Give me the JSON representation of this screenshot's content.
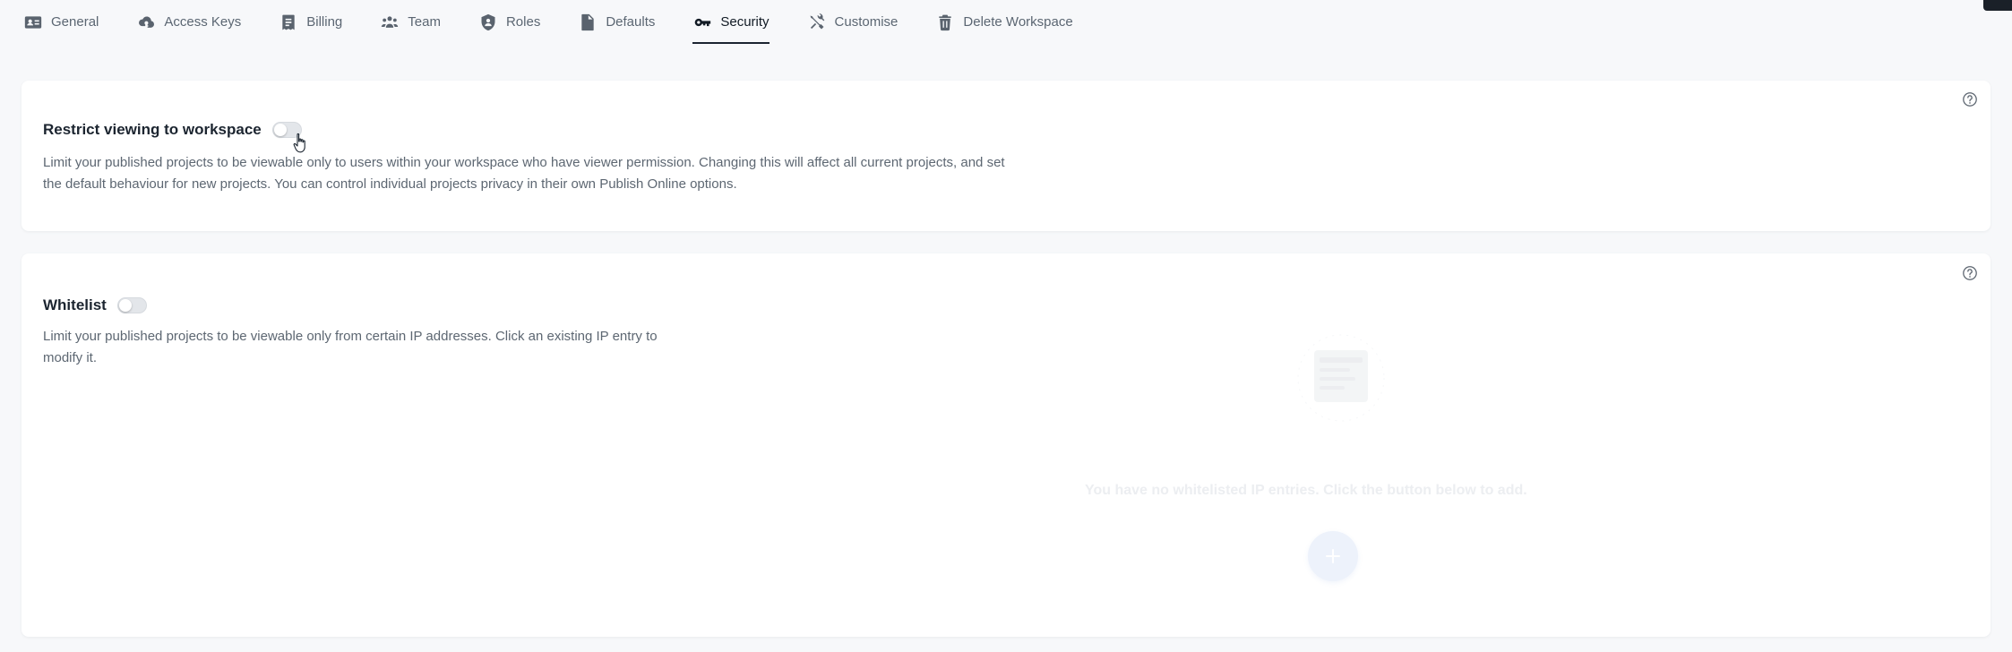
{
  "tabs": [
    {
      "label": "General",
      "icon": "id-card-icon"
    },
    {
      "label": "Access Keys",
      "icon": "cloud-key-icon"
    },
    {
      "label": "Billing",
      "icon": "receipt-icon"
    },
    {
      "label": "Team",
      "icon": "users-icon"
    },
    {
      "label": "Roles",
      "icon": "user-shield-icon"
    },
    {
      "label": "Defaults",
      "icon": "file-icon"
    },
    {
      "label": "Security",
      "icon": "key-icon",
      "active": true
    },
    {
      "label": "Customise",
      "icon": "tools-icon"
    },
    {
      "label": "Delete Workspace",
      "icon": "trash-icon"
    }
  ],
  "restrict": {
    "title": "Restrict viewing to workspace",
    "enabled": false,
    "description": "Limit your published projects to be viewable only to users within your workspace who have viewer permission. Changing this will affect all current projects, and set the default behaviour for new projects. You can control individual projects privacy in their own Publish Online options."
  },
  "whitelist": {
    "title": "Whitelist",
    "enabled": false,
    "description": "Limit your published projects to be viewable only from certain IP addresses. Click an existing IP entry to modify it.",
    "empty_text": "You have no whitelisted IP entries. Click the button below to add."
  },
  "colors": {
    "accent": "#1b2430",
    "background": "#f7f8fa",
    "card": "#ffffff",
    "muted_text": "#5d6772"
  }
}
